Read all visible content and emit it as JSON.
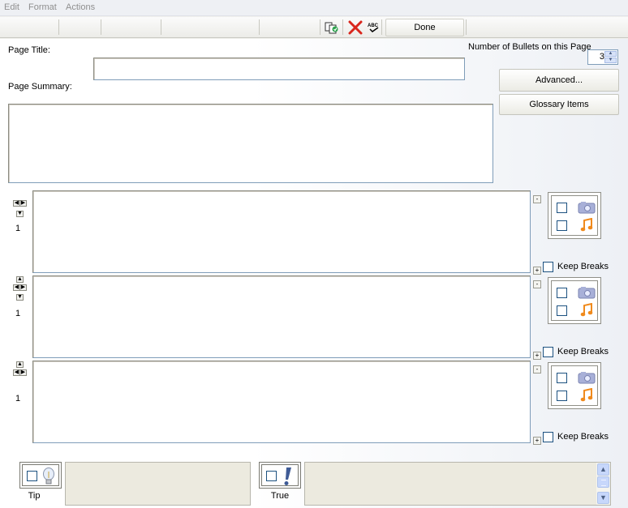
{
  "menu": {
    "items": [
      "Edit",
      "Format",
      "Actions"
    ]
  },
  "toolbar": {
    "done_label": "Done",
    "icons": [
      "copy-page-icon",
      "delete-x-icon",
      "spell-check-icon"
    ]
  },
  "form": {
    "page_title_label": "Page Title:",
    "page_title_value": "",
    "page_summary_label": "Page Summary:",
    "page_summary_value": "",
    "bullets_label": "Number of Bullets on this Page",
    "bullets_count": "3",
    "advanced_label": "Advanced...",
    "glossary_label": "Glossary Items"
  },
  "bullets": [
    {
      "number": "1",
      "text": "",
      "keep_breaks_label": "Keep Breaks"
    },
    {
      "number": "1",
      "text": "",
      "keep_breaks_label": "Keep Breaks"
    },
    {
      "number": "1",
      "text": "",
      "keep_breaks_label": "Keep Breaks"
    }
  ],
  "bottom": {
    "tip_label": "Tip",
    "true_label": "True"
  },
  "colors": {
    "accent_blue": "#7f9db9",
    "scroll_blue": "#c7d7fb",
    "panel_beige": "#eceadf",
    "delete_red": "#d9261c",
    "music_orange": "#f08a1c"
  }
}
